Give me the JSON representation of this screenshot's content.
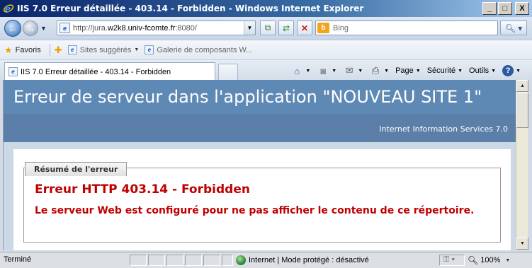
{
  "window": {
    "title": "IIS 7.0 Erreur détaillée - 403.14 - Forbidden - Windows Internet Explorer",
    "min_glyph": "_",
    "max_glyph": "□",
    "close_glyph": "X"
  },
  "address": {
    "url_prefix": "http://jura.",
    "url_host": "w2k8.univ-fcomte.fr",
    "url_suffix": ":8080/",
    "search_placeholder": "Bing"
  },
  "favorites": {
    "label": "Favoris",
    "items": [
      {
        "label": "Sites suggérés"
      },
      {
        "label": "Galerie de composants W..."
      }
    ]
  },
  "tab": {
    "label": "IIS 7.0 Erreur détaillée - 403.14 - Forbidden"
  },
  "commands": {
    "page": "Page",
    "security": "Sécurité",
    "tools": "Outils"
  },
  "page": {
    "title": "Erreur de serveur dans l'application \"NOUVEAU SITE 1\"",
    "subtitle": "Internet Information Services 7.0",
    "summary_legend": "Résumé de l'erreur",
    "error_heading": "Erreur HTTP 403.14 - Forbidden",
    "error_message": "Le serveur Web est configuré pour ne pas afficher le contenu de ce répertoire."
  },
  "status": {
    "text": "Terminé",
    "zone": "Internet | Mode protégé : désactivé",
    "zoom": "100%"
  },
  "colors": {
    "header_blue": "#5f89b5",
    "error_red": "#c00000",
    "body_bg": "#cbd9e6"
  }
}
